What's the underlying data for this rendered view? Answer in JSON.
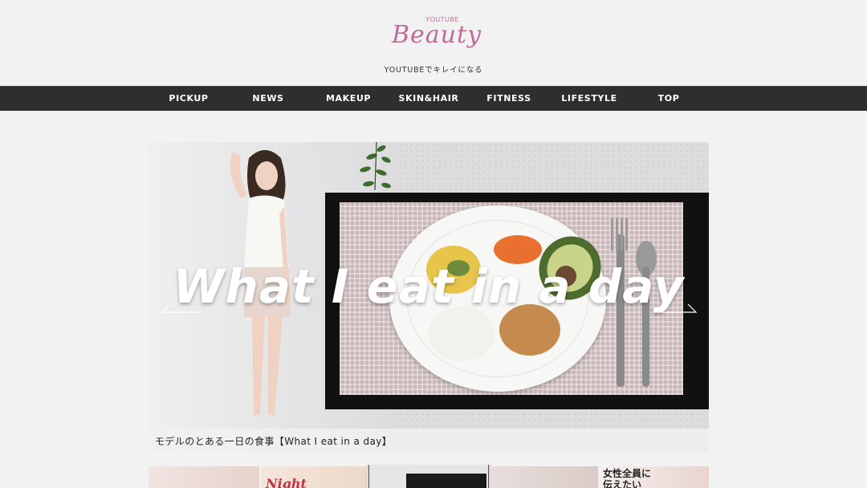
{
  "header": {
    "logo_small": "YOUTUBE",
    "logo_big": "Beauty",
    "tagline": "YOUTUBEでキレイになる"
  },
  "nav": {
    "items": [
      {
        "label": "PICKUP"
      },
      {
        "label": "NEWS"
      },
      {
        "label": "MAKEUP"
      },
      {
        "label": "SKIN&HAIR"
      },
      {
        "label": "FITNESS"
      },
      {
        "label": "LIFESTYLE"
      },
      {
        "label": "TOP"
      }
    ]
  },
  "slider": {
    "title": "What I eat in a day",
    "caption": "モデルのとある一日の食事【What I eat in a day】"
  },
  "thumbnails": [
    {
      "text": ""
    },
    {
      "text": "Night"
    },
    {
      "text": ""
    },
    {
      "text": ""
    },
    {
      "text": "女性全員に 伝えたい"
    }
  ],
  "colors": {
    "brand": "#c06a97",
    "nav_bg": "#2e2e2e",
    "page_bg": "#f2f2f2"
  },
  "icons": {
    "prev": "arrow-left-icon",
    "next": "arrow-right-icon"
  }
}
